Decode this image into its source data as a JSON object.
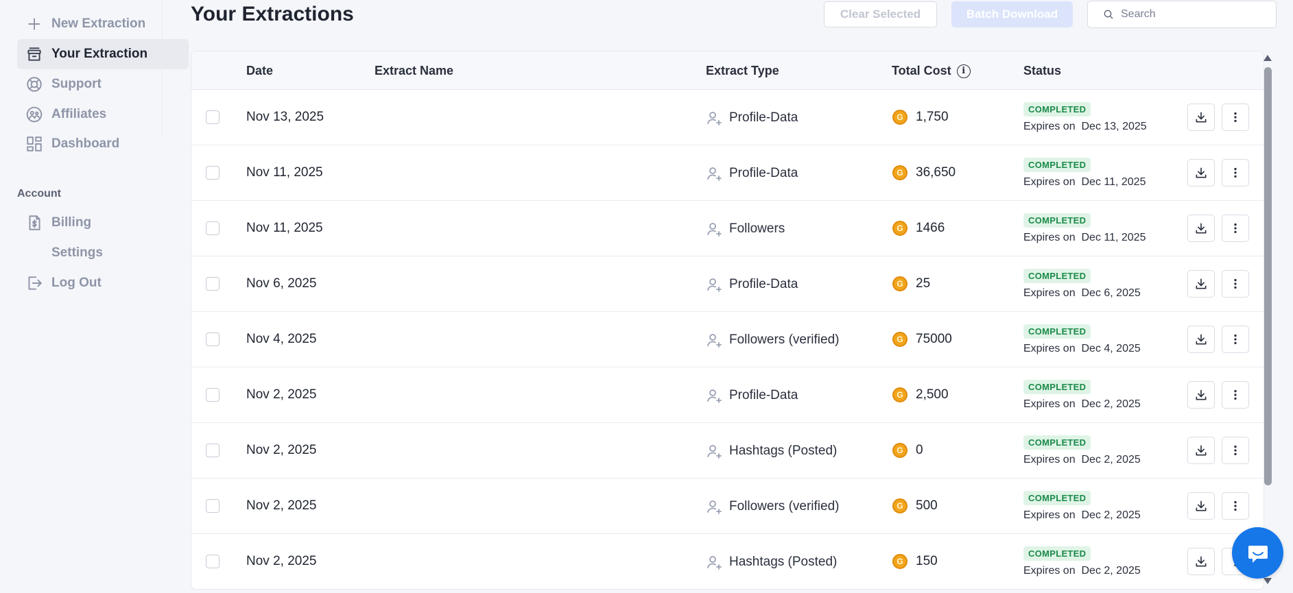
{
  "sidebar": {
    "items": [
      {
        "label": "New Extraction",
        "icon": "plus-icon"
      },
      {
        "label": "Your Extraction",
        "icon": "archive-icon",
        "active": true
      },
      {
        "label": "Support",
        "icon": "lifebuoy-icon"
      },
      {
        "label": "Affiliates",
        "icon": "affiliates-icon"
      },
      {
        "label": "Dashboard",
        "icon": "dashboard-icon"
      }
    ],
    "account_label": "Account",
    "account_items": [
      {
        "label": "Billing",
        "icon": "invoice-icon"
      },
      {
        "label": "Settings",
        "icon": ""
      },
      {
        "label": "Log Out",
        "icon": "logout-icon"
      }
    ]
  },
  "header": {
    "title": "Your Extractions",
    "clear_label": "Clear Selected",
    "batch_label": "Batch Download",
    "search_placeholder": "Search"
  },
  "table": {
    "columns": {
      "date": "Date",
      "name": "Extract Name",
      "type": "Extract Type",
      "cost": "Total Cost",
      "status": "Status"
    },
    "rows": [
      {
        "date": "Nov 13, 2025",
        "type": "Profile-Data",
        "cost": "1,750",
        "status": "COMPLETED",
        "expires_label": "Expires on",
        "expires": "Dec 13, 2025"
      },
      {
        "date": "Nov 11, 2025",
        "type": "Profile-Data",
        "cost": "36,650",
        "status": "COMPLETED",
        "expires_label": "Expires on",
        "expires": "Dec 11, 2025"
      },
      {
        "date": "Nov 11, 2025",
        "type": "Followers",
        "cost": "1466",
        "status": "COMPLETED",
        "expires_label": "Expires on",
        "expires": "Dec 11, 2025"
      },
      {
        "date": "Nov 6, 2025",
        "type": "Profile-Data",
        "cost": "25",
        "status": "COMPLETED",
        "expires_label": "Expires on",
        "expires": "Dec 6, 2025"
      },
      {
        "date": "Nov 4, 2025",
        "type": "Followers (verified)",
        "cost": "75000",
        "status": "COMPLETED",
        "expires_label": "Expires on",
        "expires": "Dec 4, 2025"
      },
      {
        "date": "Nov 2, 2025",
        "type": "Profile-Data",
        "cost": "2,500",
        "status": "COMPLETED",
        "expires_label": "Expires on",
        "expires": "Dec 2, 2025"
      },
      {
        "date": "Nov 2, 2025",
        "type": "Hashtags (Posted)",
        "cost": "0",
        "status": "COMPLETED",
        "expires_label": "Expires on",
        "expires": "Dec 2, 2025"
      },
      {
        "date": "Nov 2, 2025",
        "type": "Followers (verified)",
        "cost": "500",
        "status": "COMPLETED",
        "expires_label": "Expires on",
        "expires": "Dec 2, 2025"
      },
      {
        "date": "Nov 2, 2025",
        "type": "Hashtags (Posted)",
        "cost": "150",
        "status": "COMPLETED",
        "expires_label": "Expires on",
        "expires": "Dec 2, 2025"
      }
    ]
  },
  "coin_glyph": "G",
  "colors": {
    "badge_bg": "#dff4e6",
    "badge_text": "#1b8a49",
    "coin": "#f2a51c",
    "chat": "#1677e8",
    "active_nav": "#e8eaf0"
  }
}
